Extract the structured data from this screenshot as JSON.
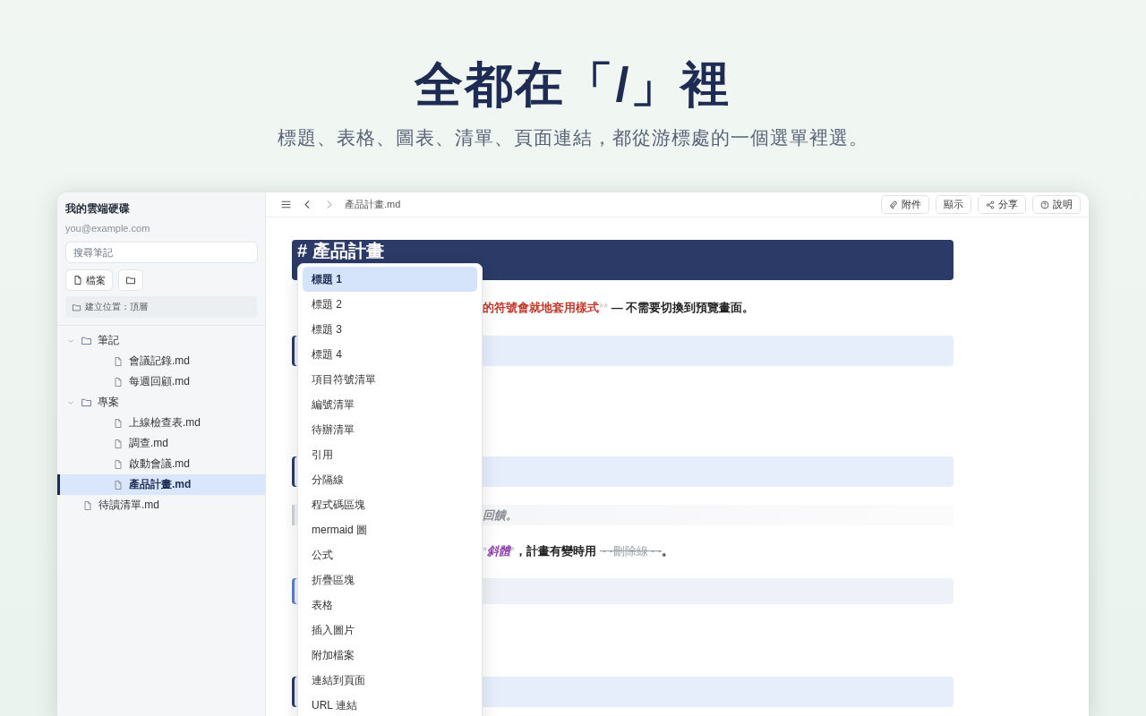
{
  "hero": {
    "title": "全都在「/」裡",
    "subtitle": "標題、表格、圖表、清單、頁面連結，都從游標處的一個選單裡選。"
  },
  "sidebar": {
    "drive_name": "我的雲端硬碟",
    "email": "you@example.com",
    "search": {
      "placeholder": "搜尋筆記"
    },
    "buttons": [
      {
        "kind": "file",
        "label": "檔案"
      },
      {
        "kind": "folder"
      }
    ],
    "location": "建立位置：頂層",
    "tree": [
      {
        "kind": "folder",
        "label": "筆記",
        "expanded": true,
        "selected": false,
        "children": [
          {
            "kind": "file",
            "label": "會議記錄.md",
            "selected": false
          },
          {
            "kind": "file",
            "label": "每週回顧.md",
            "selected": false
          }
        ]
      },
      {
        "kind": "folder",
        "label": "專案",
        "expanded": true,
        "selected": false,
        "children": [
          {
            "kind": "file",
            "label": "上線檢查表.md",
            "selected": false
          },
          {
            "kind": "file",
            "label": "調查.md",
            "selected": false
          },
          {
            "kind": "file",
            "label": "啟動會議.md",
            "selected": false
          },
          {
            "kind": "file",
            "label": "產品計畫.md",
            "selected": true
          }
        ]
      },
      {
        "kind": "file",
        "label": "待讀清單.md",
        "selected": false
      }
    ]
  },
  "toolbar": {
    "breadcrumb": "產品計畫.md",
    "buttons": [
      {
        "kind": "attach",
        "label": "附件"
      },
      {
        "kind": "plain",
        "label": "顯示"
      },
      {
        "kind": "share",
        "label": "分享"
      },
      {
        "kind": "help",
        "label": "說明"
      }
    ]
  },
  "editor": {
    "blocks": [
      {
        "kind": "heading1",
        "text": "# 產品計畫"
      },
      {
        "kind": "paragraph",
        "runs": [
          {
            "kind": "accent",
            "text": "的符號會就地套用樣式"
          },
          {
            "kind": "marker",
            "text": "**"
          },
          {
            "kind": "plain",
            "text": " — 不需要切換到預覽畫面。"
          }
        ]
      },
      {
        "kind": "heading2"
      },
      {
        "kind": "heading2"
      },
      {
        "kind": "quote",
        "runs": [
          {
            "kind": "plain",
            "text": "回饋。"
          }
        ]
      },
      {
        "kind": "paragraph",
        "runs": [
          {
            "kind": "marker",
            "text": "*"
          },
          {
            "kind": "italic",
            "text": "斜體"
          },
          {
            "kind": "marker",
            "text": "*"
          },
          {
            "kind": "plain",
            "text": "，計畫有變時用 "
          },
          {
            "kind": "strike",
            "text": "~~刪除線~~"
          },
          {
            "kind": "plain",
            "text": "。"
          }
        ]
      },
      {
        "kind": "callout"
      },
      {
        "kind": "heading2"
      }
    ]
  },
  "slash_menu": {
    "items": [
      {
        "label": "標題 1",
        "selected": true
      },
      {
        "label": "標題 2",
        "selected": false
      },
      {
        "label": "標題 3",
        "selected": false
      },
      {
        "label": "標題 4",
        "selected": false
      },
      {
        "label": "項目符號清單",
        "selected": false
      },
      {
        "label": "編號清單",
        "selected": false
      },
      {
        "label": "待辦清單",
        "selected": false
      },
      {
        "label": "引用",
        "selected": false
      },
      {
        "label": "分隔線",
        "selected": false
      },
      {
        "label": "程式碼區塊",
        "selected": false
      },
      {
        "label": "mermaid 圖",
        "selected": false
      },
      {
        "label": "公式",
        "selected": false
      },
      {
        "label": "折疊區塊",
        "selected": false
      },
      {
        "label": "表格",
        "selected": false
      },
      {
        "label": "插入圖片",
        "selected": false
      },
      {
        "label": "附加檔案",
        "selected": false
      },
      {
        "label": "連結到頁面",
        "selected": false
      },
      {
        "label": "URL 連結",
        "selected": false
      }
    ]
  }
}
